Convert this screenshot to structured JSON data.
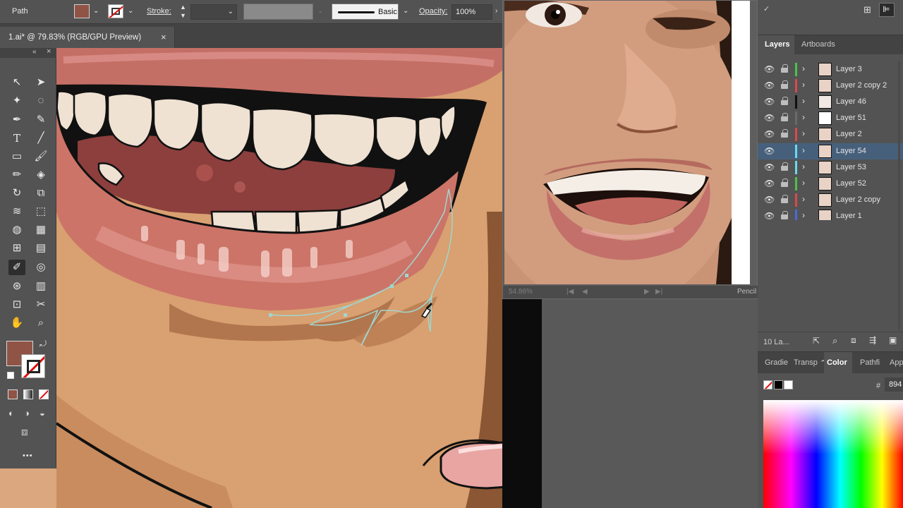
{
  "control_bar": {
    "selection_label": "Path",
    "stroke_label": "Stroke:",
    "brush_label": "Basic",
    "opacity_label": "Opacity:",
    "opacity_value": "100%",
    "fill_color": "#8f5446"
  },
  "document": {
    "tab_title": "1.ai* @ 79.83% (RGB/GPU Preview)",
    "close_glyph": "×"
  },
  "tools_panel": {
    "more_tools": "•••",
    "fill_color": "#8f5446"
  },
  "reference_window": {
    "zoom_text": "54.86%",
    "tool_label": "Pencil"
  },
  "layers_panel": {
    "tabs": [
      "Layers",
      "Artboards"
    ],
    "active_tab": "Layers",
    "layers": [
      {
        "name": "Layer 3",
        "color": "#4ac34a",
        "selected": false,
        "locked": true
      },
      {
        "name": "Layer 2 copy 2",
        "color": "#d84a4a",
        "selected": false,
        "locked": true
      },
      {
        "name": "Layer 46",
        "color": "#111111",
        "selected": false,
        "locked": true
      },
      {
        "name": "Layer 51",
        "color": "#6a6a6a",
        "selected": false,
        "locked": true
      },
      {
        "name": "Layer 2",
        "color": "#d84a4a",
        "selected": false,
        "locked": true
      },
      {
        "name": "Layer 54",
        "color": "#6ad8f0",
        "selected": true,
        "locked": false
      },
      {
        "name": "Layer 53",
        "color": "#6ad8f0",
        "selected": false,
        "locked": true
      },
      {
        "name": "Layer 52",
        "color": "#4ac34a",
        "selected": false,
        "locked": true
      },
      {
        "name": "Layer 2 copy",
        "color": "#d84a4a",
        "selected": false,
        "locked": true
      },
      {
        "name": "Layer 1",
        "color": "#4a6ad8",
        "selected": false,
        "locked": true
      }
    ],
    "footer_count": "10 La..."
  },
  "color_panel": {
    "tabs": [
      "Gradie",
      "Transp",
      "Color",
      "Pathfi",
      "App"
    ],
    "active_tab": "Color",
    "hex_symbol": "#",
    "hex_value": "894"
  }
}
